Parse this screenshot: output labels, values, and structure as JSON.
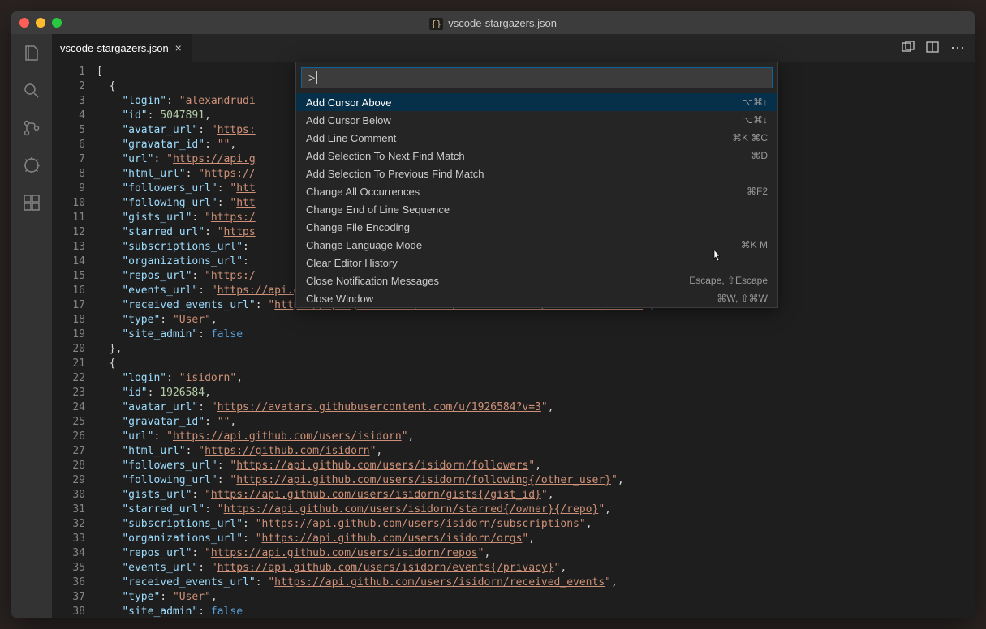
{
  "window_title": "vscode-stargazers.json",
  "tab": {
    "label": "vscode-stargazers.json"
  },
  "palette": {
    "input_value": ">",
    "items": [
      {
        "label": "Add Cursor Above",
        "shortcut": "⌥⌘↑",
        "selected": true
      },
      {
        "label": "Add Cursor Below",
        "shortcut": "⌥⌘↓"
      },
      {
        "label": "Add Line Comment",
        "shortcut": "⌘K ⌘C"
      },
      {
        "label": "Add Selection To Next Find Match",
        "shortcut": "⌘D"
      },
      {
        "label": "Add Selection To Previous Find Match",
        "shortcut": ""
      },
      {
        "label": "Change All Occurrences",
        "shortcut": "⌘F2"
      },
      {
        "label": "Change End of Line Sequence",
        "shortcut": ""
      },
      {
        "label": "Change File Encoding",
        "shortcut": ""
      },
      {
        "label": "Change Language Mode",
        "shortcut": "⌘K M"
      },
      {
        "label": "Clear Editor History",
        "shortcut": ""
      },
      {
        "label": "Close Notification Messages",
        "shortcut": "Escape, ⇧Escape"
      },
      {
        "label": "Close Window",
        "shortcut": "⌘W, ⇧⌘W"
      }
    ]
  },
  "code_lines": [
    {
      "n": 1,
      "indent": 0,
      "tokens": [
        {
          "t": "[",
          "c": "punct"
        }
      ]
    },
    {
      "n": 2,
      "indent": 1,
      "tokens": [
        {
          "t": "{",
          "c": "punct"
        }
      ]
    },
    {
      "n": 3,
      "indent": 2,
      "tokens": [
        {
          "t": "\"login\"",
          "c": "key"
        },
        {
          "t": ": ",
          "c": "punct"
        },
        {
          "t": "\"alexandrudi",
          "c": "str"
        }
      ]
    },
    {
      "n": 4,
      "indent": 2,
      "tokens": [
        {
          "t": "\"id\"",
          "c": "key"
        },
        {
          "t": ": ",
          "c": "punct"
        },
        {
          "t": "5047891",
          "c": "num"
        },
        {
          "t": ",",
          "c": "punct"
        }
      ]
    },
    {
      "n": 5,
      "indent": 2,
      "tokens": [
        {
          "t": "\"avatar_url\"",
          "c": "key"
        },
        {
          "t": ": ",
          "c": "punct"
        },
        {
          "t": "\"",
          "c": "str"
        },
        {
          "t": "https:",
          "c": "str url"
        }
      ]
    },
    {
      "n": 6,
      "indent": 2,
      "tokens": [
        {
          "t": "\"gravatar_id\"",
          "c": "key"
        },
        {
          "t": ": ",
          "c": "punct"
        },
        {
          "t": "\"\"",
          "c": "str"
        },
        {
          "t": ",",
          "c": "punct"
        }
      ]
    },
    {
      "n": 7,
      "indent": 2,
      "tokens": [
        {
          "t": "\"url\"",
          "c": "key"
        },
        {
          "t": ": ",
          "c": "punct"
        },
        {
          "t": "\"",
          "c": "str"
        },
        {
          "t": "https://api.g",
          "c": "str url"
        }
      ]
    },
    {
      "n": 8,
      "indent": 2,
      "tokens": [
        {
          "t": "\"html_url\"",
          "c": "key"
        },
        {
          "t": ": ",
          "c": "punct"
        },
        {
          "t": "\"",
          "c": "str"
        },
        {
          "t": "https://",
          "c": "str url"
        }
      ]
    },
    {
      "n": 9,
      "indent": 2,
      "tokens": [
        {
          "t": "\"followers_url\"",
          "c": "key"
        },
        {
          "t": ": ",
          "c": "punct"
        },
        {
          "t": "\"",
          "c": "str"
        },
        {
          "t": "htt",
          "c": "str url"
        }
      ]
    },
    {
      "n": 10,
      "indent": 2,
      "tokens": [
        {
          "t": "\"following_url\"",
          "c": "key"
        },
        {
          "t": ": ",
          "c": "punct"
        },
        {
          "t": "\"",
          "c": "str"
        },
        {
          "t": "htt",
          "c": "str url"
        }
      ]
    },
    {
      "n": 11,
      "indent": 2,
      "tokens": [
        {
          "t": "\"gists_url\"",
          "c": "key"
        },
        {
          "t": ": ",
          "c": "punct"
        },
        {
          "t": "\"",
          "c": "str"
        },
        {
          "t": "https:/",
          "c": "str url"
        }
      ]
    },
    {
      "n": 12,
      "indent": 2,
      "tokens": [
        {
          "t": "\"starred_url\"",
          "c": "key"
        },
        {
          "t": ": ",
          "c": "punct"
        },
        {
          "t": "\"",
          "c": "str"
        },
        {
          "t": "https",
          "c": "str url"
        }
      ]
    },
    {
      "n": 13,
      "indent": 2,
      "tokens": [
        {
          "t": "\"subscriptions_url\"",
          "c": "key"
        },
        {
          "t": ":",
          "c": "punct"
        }
      ]
    },
    {
      "n": 14,
      "indent": 2,
      "tokens": [
        {
          "t": "\"organizations_url\"",
          "c": "key"
        },
        {
          "t": ":",
          "c": "punct"
        }
      ]
    },
    {
      "n": 15,
      "indent": 2,
      "tokens": [
        {
          "t": "\"repos_url\"",
          "c": "key"
        },
        {
          "t": ": ",
          "c": "punct"
        },
        {
          "t": "\"",
          "c": "str"
        },
        {
          "t": "https:/",
          "c": "str url"
        }
      ]
    },
    {
      "n": 16,
      "indent": 2,
      "tokens": [
        {
          "t": "\"events_url\"",
          "c": "key"
        },
        {
          "t": ": ",
          "c": "punct"
        },
        {
          "t": "\"",
          "c": "str"
        },
        {
          "t": "https://api.github.com/users/alexandrudima/events{/privacy}",
          "c": "str url"
        },
        {
          "t": "\"",
          "c": "str"
        },
        {
          "t": ",",
          "c": "punct"
        }
      ]
    },
    {
      "n": 17,
      "indent": 2,
      "tokens": [
        {
          "t": "\"received_events_url\"",
          "c": "key"
        },
        {
          "t": ": ",
          "c": "punct"
        },
        {
          "t": "\"",
          "c": "str"
        },
        {
          "t": "https://api.github.com/users/alexandrudima/received_events",
          "c": "str url"
        },
        {
          "t": "\"",
          "c": "str"
        },
        {
          "t": ",",
          "c": "punct"
        }
      ]
    },
    {
      "n": 18,
      "indent": 2,
      "tokens": [
        {
          "t": "\"type\"",
          "c": "key"
        },
        {
          "t": ": ",
          "c": "punct"
        },
        {
          "t": "\"User\"",
          "c": "str"
        },
        {
          "t": ",",
          "c": "punct"
        }
      ]
    },
    {
      "n": 19,
      "indent": 2,
      "tokens": [
        {
          "t": "\"site_admin\"",
          "c": "key"
        },
        {
          "t": ": ",
          "c": "punct"
        },
        {
          "t": "false",
          "c": "kw"
        }
      ]
    },
    {
      "n": 20,
      "indent": 1,
      "tokens": [
        {
          "t": "},",
          "c": "punct"
        }
      ]
    },
    {
      "n": 21,
      "indent": 1,
      "tokens": [
        {
          "t": "{",
          "c": "punct"
        }
      ]
    },
    {
      "n": 22,
      "indent": 2,
      "tokens": [
        {
          "t": "\"login\"",
          "c": "key"
        },
        {
          "t": ": ",
          "c": "punct"
        },
        {
          "t": "\"isidorn\"",
          "c": "str"
        },
        {
          "t": ",",
          "c": "punct"
        }
      ]
    },
    {
      "n": 23,
      "indent": 2,
      "tokens": [
        {
          "t": "\"id\"",
          "c": "key"
        },
        {
          "t": ": ",
          "c": "punct"
        },
        {
          "t": "1926584",
          "c": "num"
        },
        {
          "t": ",",
          "c": "punct"
        }
      ]
    },
    {
      "n": 24,
      "indent": 2,
      "tokens": [
        {
          "t": "\"avatar_url\"",
          "c": "key"
        },
        {
          "t": ": ",
          "c": "punct"
        },
        {
          "t": "\"",
          "c": "str"
        },
        {
          "t": "https://avatars.githubusercontent.com/u/1926584?v=3",
          "c": "str url"
        },
        {
          "t": "\"",
          "c": "str"
        },
        {
          "t": ",",
          "c": "punct"
        }
      ]
    },
    {
      "n": 25,
      "indent": 2,
      "tokens": [
        {
          "t": "\"gravatar_id\"",
          "c": "key"
        },
        {
          "t": ": ",
          "c": "punct"
        },
        {
          "t": "\"\"",
          "c": "str"
        },
        {
          "t": ",",
          "c": "punct"
        }
      ]
    },
    {
      "n": 26,
      "indent": 2,
      "tokens": [
        {
          "t": "\"url\"",
          "c": "key"
        },
        {
          "t": ": ",
          "c": "punct"
        },
        {
          "t": "\"",
          "c": "str"
        },
        {
          "t": "https://api.github.com/users/isidorn",
          "c": "str url"
        },
        {
          "t": "\"",
          "c": "str"
        },
        {
          "t": ",",
          "c": "punct"
        }
      ]
    },
    {
      "n": 27,
      "indent": 2,
      "tokens": [
        {
          "t": "\"html_url\"",
          "c": "key"
        },
        {
          "t": ": ",
          "c": "punct"
        },
        {
          "t": "\"",
          "c": "str"
        },
        {
          "t": "https://github.com/isidorn",
          "c": "str url"
        },
        {
          "t": "\"",
          "c": "str"
        },
        {
          "t": ",",
          "c": "punct"
        }
      ]
    },
    {
      "n": 28,
      "indent": 2,
      "tokens": [
        {
          "t": "\"followers_url\"",
          "c": "key"
        },
        {
          "t": ": ",
          "c": "punct"
        },
        {
          "t": "\"",
          "c": "str"
        },
        {
          "t": "https://api.github.com/users/isidorn/followers",
          "c": "str url"
        },
        {
          "t": "\"",
          "c": "str"
        },
        {
          "t": ",",
          "c": "punct"
        }
      ]
    },
    {
      "n": 29,
      "indent": 2,
      "tokens": [
        {
          "t": "\"following_url\"",
          "c": "key"
        },
        {
          "t": ": ",
          "c": "punct"
        },
        {
          "t": "\"",
          "c": "str"
        },
        {
          "t": "https://api.github.com/users/isidorn/following{/other_user}",
          "c": "str url"
        },
        {
          "t": "\"",
          "c": "str"
        },
        {
          "t": ",",
          "c": "punct"
        }
      ]
    },
    {
      "n": 30,
      "indent": 2,
      "tokens": [
        {
          "t": "\"gists_url\"",
          "c": "key"
        },
        {
          "t": ": ",
          "c": "punct"
        },
        {
          "t": "\"",
          "c": "str"
        },
        {
          "t": "https://api.github.com/users/isidorn/gists{/gist_id}",
          "c": "str url"
        },
        {
          "t": "\"",
          "c": "str"
        },
        {
          "t": ",",
          "c": "punct"
        }
      ]
    },
    {
      "n": 31,
      "indent": 2,
      "tokens": [
        {
          "t": "\"starred_url\"",
          "c": "key"
        },
        {
          "t": ": ",
          "c": "punct"
        },
        {
          "t": "\"",
          "c": "str"
        },
        {
          "t": "https://api.github.com/users/isidorn/starred{/owner}{/repo}",
          "c": "str url"
        },
        {
          "t": "\"",
          "c": "str"
        },
        {
          "t": ",",
          "c": "punct"
        }
      ]
    },
    {
      "n": 32,
      "indent": 2,
      "tokens": [
        {
          "t": "\"subscriptions_url\"",
          "c": "key"
        },
        {
          "t": ": ",
          "c": "punct"
        },
        {
          "t": "\"",
          "c": "str"
        },
        {
          "t": "https://api.github.com/users/isidorn/subscriptions",
          "c": "str url"
        },
        {
          "t": "\"",
          "c": "str"
        },
        {
          "t": ",",
          "c": "punct"
        }
      ]
    },
    {
      "n": 33,
      "indent": 2,
      "tokens": [
        {
          "t": "\"organizations_url\"",
          "c": "key"
        },
        {
          "t": ": ",
          "c": "punct"
        },
        {
          "t": "\"",
          "c": "str"
        },
        {
          "t": "https://api.github.com/users/isidorn/orgs",
          "c": "str url"
        },
        {
          "t": "\"",
          "c": "str"
        },
        {
          "t": ",",
          "c": "punct"
        }
      ]
    },
    {
      "n": 34,
      "indent": 2,
      "tokens": [
        {
          "t": "\"repos_url\"",
          "c": "key"
        },
        {
          "t": ": ",
          "c": "punct"
        },
        {
          "t": "\"",
          "c": "str"
        },
        {
          "t": "https://api.github.com/users/isidorn/repos",
          "c": "str url"
        },
        {
          "t": "\"",
          "c": "str"
        },
        {
          "t": ",",
          "c": "punct"
        }
      ]
    },
    {
      "n": 35,
      "indent": 2,
      "tokens": [
        {
          "t": "\"events_url\"",
          "c": "key"
        },
        {
          "t": ": ",
          "c": "punct"
        },
        {
          "t": "\"",
          "c": "str"
        },
        {
          "t": "https://api.github.com/users/isidorn/events{/privacy}",
          "c": "str url"
        },
        {
          "t": "\"",
          "c": "str"
        },
        {
          "t": ",",
          "c": "punct"
        }
      ]
    },
    {
      "n": 36,
      "indent": 2,
      "tokens": [
        {
          "t": "\"received_events_url\"",
          "c": "key"
        },
        {
          "t": ": ",
          "c": "punct"
        },
        {
          "t": "\"",
          "c": "str"
        },
        {
          "t": "https://api.github.com/users/isidorn/received_events",
          "c": "str url"
        },
        {
          "t": "\"",
          "c": "str"
        },
        {
          "t": ",",
          "c": "punct"
        }
      ]
    },
    {
      "n": 37,
      "indent": 2,
      "tokens": [
        {
          "t": "\"type\"",
          "c": "key"
        },
        {
          "t": ": ",
          "c": "punct"
        },
        {
          "t": "\"User\"",
          "c": "str"
        },
        {
          "t": ",",
          "c": "punct"
        }
      ]
    },
    {
      "n": 38,
      "indent": 2,
      "tokens": [
        {
          "t": "\"site_admin\"",
          "c": "key"
        },
        {
          "t": ": ",
          "c": "punct"
        },
        {
          "t": "false",
          "c": "kw"
        }
      ]
    }
  ]
}
